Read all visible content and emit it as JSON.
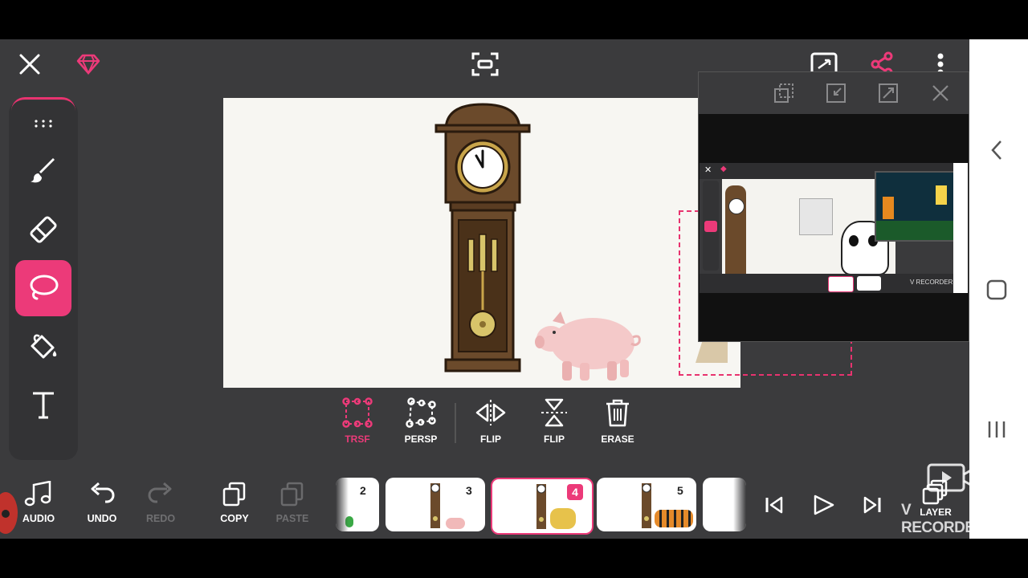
{
  "colors": {
    "accent": "#ec3a79",
    "background": "#3b3b3d",
    "canvas": "#f7f6f2"
  },
  "topbar": {
    "icons": [
      "close-icon",
      "premium-gem-icon",
      "fit-screen-icon",
      "fullscreen-icon",
      "share-icon",
      "more-vertical-icon"
    ]
  },
  "left_toolbar": {
    "tools": [
      "drag-handle-icon",
      "brush-icon",
      "eraser-icon",
      "lasso-icon",
      "fill-bucket-icon",
      "text-icon"
    ],
    "active_tool": "lasso"
  },
  "transform_bar": {
    "buttons": [
      {
        "label": "TRSF",
        "icon": "transform-icon",
        "active": true
      },
      {
        "label": "PERSP",
        "icon": "perspective-icon",
        "active": false
      },
      {
        "label": "FLIP",
        "icon": "flip-horizontal-icon",
        "active": false
      },
      {
        "label": "FLIP",
        "icon": "flip-vertical-icon",
        "active": false
      },
      {
        "label": "ERASE",
        "icon": "trash-icon",
        "active": false
      }
    ]
  },
  "bottom_bar": {
    "audio": "AUDIO",
    "undo": "UNDO",
    "redo": "REDO",
    "copy": "COPY",
    "paste": "PASTE",
    "layer": "LAYER"
  },
  "frames": [
    {
      "number": "2",
      "selected": false
    },
    {
      "number": "3",
      "selected": false
    },
    {
      "number": "4",
      "selected": true
    },
    {
      "number": "5",
      "selected": false
    }
  ],
  "recorder_watermark": "V RECORDER",
  "mini_preview": {
    "label": "V RECORDER"
  }
}
